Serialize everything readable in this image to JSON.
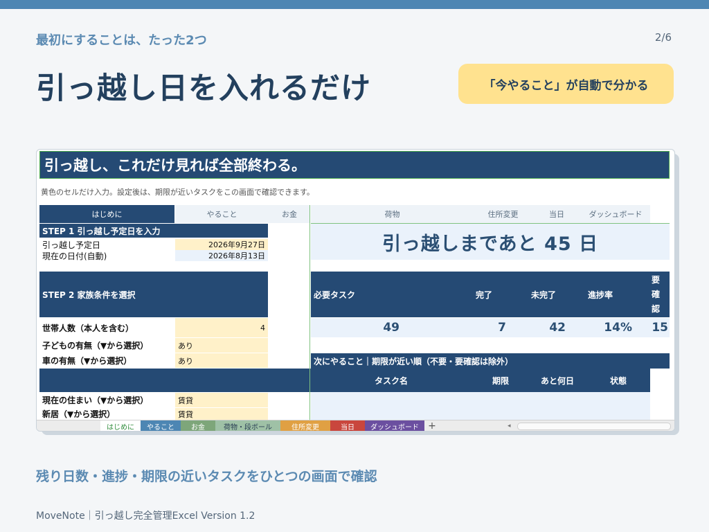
{
  "slide": {
    "subtitle": "最初にすることは、たった2つ",
    "page": "2/6",
    "headline": "引っ越し日を入れるだけ",
    "callout": "「今やること」が自動で分かる",
    "bottom_caption": "残り日数・進捗・期限の近いタスクをひとつの画面で確認",
    "footer": "MoveNote｜引っ越し完全管理Excel  Version 1.2"
  },
  "sheet": {
    "title": "引っ越し、これだけ見れば全部終わる。",
    "note": "黄色のセルだけ入力。設定後は、期限が近いタスクをこの画面で確認できます。",
    "tabs": [
      "はじめに",
      "やること",
      "お金",
      "荷物",
      "住所変更",
      "当日",
      "ダッシュボード"
    ],
    "step1": {
      "header": "STEP 1  引っ越し予定日を入力",
      "move_date_label": "引っ越し予定日",
      "move_date_value": "2026年9月27日",
      "today_label": "現在の日付(自動)",
      "today_value": "2026年8月13日"
    },
    "step2": {
      "header": "STEP 2  家族条件を選択",
      "rows": [
        {
          "label": "世帯人数（本人を含む）",
          "value": "4"
        },
        {
          "label": "子どもの有無（▼から選択）",
          "value": "あり"
        },
        {
          "label": "車の有無（▼から選択）",
          "value": "あり"
        },
        {
          "label": "現在の住まい（▼から選択）",
          "value": "賃貸"
        },
        {
          "label": "新居（▼から選択）",
          "value": "賃貸"
        }
      ]
    },
    "countdown": "引っ越しまであと 45 日",
    "stats": {
      "headers": [
        "必要タスク",
        "完了",
        "未完了",
        "進捗率",
        "要確認"
      ],
      "values": [
        "49",
        "7",
        "42",
        "14%",
        "15"
      ]
    },
    "next": {
      "title": "次にやること｜期限が近い順（不要・要確認は除外）",
      "columns": [
        "タスク名",
        "期限",
        "あと何日",
        "状態"
      ]
    },
    "sheet_tabs": [
      {
        "label": "はじめに",
        "color": "#ffffff"
      },
      {
        "label": "やること",
        "color": "#4d86b3"
      },
      {
        "label": "お金",
        "color": "#7ea67a"
      },
      {
        "label": "荷物・段ボール",
        "color": "#9fc1a6"
      },
      {
        "label": "住所変更",
        "color": "#e0a043"
      },
      {
        "label": "当日",
        "color": "#c9463d"
      },
      {
        "label": "ダッシュボード",
        "color": "#6b4fa0"
      }
    ]
  }
}
